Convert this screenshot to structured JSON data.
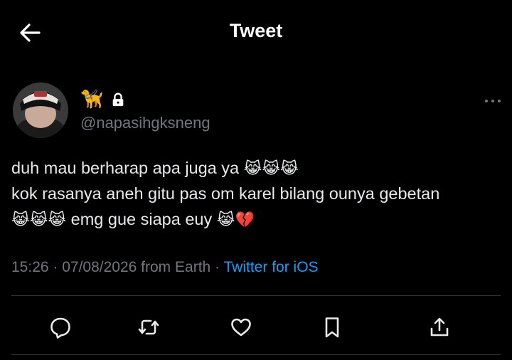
{
  "header": {
    "title": "Tweet",
    "back_icon": "arrow-left-icon"
  },
  "author": {
    "display_name_emoji": "🦮",
    "lock_icon": "lock-icon",
    "handle": "@napasihgksneng",
    "more_icon": "more-horizontal-icon"
  },
  "tweet": {
    "line1_text": "duh mau berharap apa juga ya ",
    "line1_emojis": "😹😹😹",
    "line2_text": "kok rasanya aneh gitu pas om karel bilang ounya gebetan",
    "line3_emojis_a": "😹😹😹",
    "line3_text": " emg gue siapa euy ",
    "line3_emojis_b": "😹💔"
  },
  "meta": {
    "time": "15:26",
    "sep1": " · ",
    "date": "07/08/2026",
    "location": " from Earth",
    "sep2": " · ",
    "source": "Twitter for iOS"
  },
  "actions": {
    "reply_icon": "reply-icon",
    "retweet_icon": "retweet-icon",
    "like_icon": "heart-icon",
    "bookmark_icon": "bookmark-icon",
    "share_icon": "share-icon"
  },
  "colors": {
    "background": "#000000",
    "text": "#e7e9ea",
    "muted": "#71767b",
    "link": "#1d9bf0",
    "divider": "#2f3336"
  }
}
